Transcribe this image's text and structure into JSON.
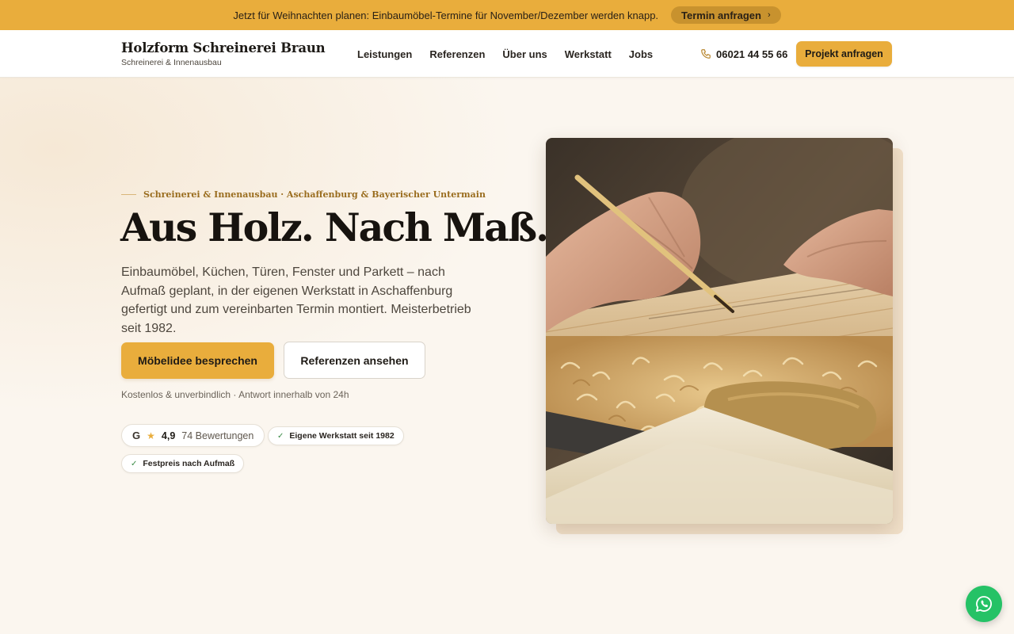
{
  "announcement": {
    "text": "Jetzt für Weihnachten planen: Einbaumöbel-Termine für November/Dezember werden knapp.",
    "button_label": "Termin anfragen",
    "button_icon": "chevron-right-icon"
  },
  "header": {
    "brand_name": "Holzform Schreinerei Braun",
    "brand_tagline": "Schreinerei & Innenausbau",
    "nav": [
      {
        "label": "Leistungen"
      },
      {
        "label": "Referenzen"
      },
      {
        "label": "Über uns"
      },
      {
        "label": "Werkstatt"
      },
      {
        "label": "Jobs"
      }
    ],
    "phone": "06021 44 55 66",
    "phone_icon": "phone-icon",
    "cta_label": "Projekt anfragen"
  },
  "hero": {
    "eyebrow": "Schreinerei & Innenausbau · Aschaffenburg & Bayerischer Untermain",
    "headline": "Aus Holz. Nach Maß.",
    "lede": "Einbaumöbel, Küchen, Türen, Fenster und Parkett – nach Aufmaß geplant, in der eigenen Werkstatt in Aschaffenburg gefertigt und zum vereinbarten Termin montiert. Meisterbetrieb seit 1982.",
    "primary_button": "Möbelidee besprechen",
    "secondary_button": "Referenzen ansehen",
    "fineprint": "Kostenlos & unverbindlich · Antwort innerhalb von 24h",
    "rating": {
      "icon": "google-icon",
      "star_icon": "star-icon",
      "score": "4,9",
      "count": "74 Bewertungen"
    },
    "badges": [
      {
        "label": "Eigene Werkstatt seit 1982",
        "icon": "check-icon"
      },
      {
        "label": "Festpreis nach Aufmaß",
        "icon": "check-icon"
      }
    ],
    "image_subject": "carpenter-marking-wood-photo"
  },
  "fab": {
    "icon": "whatsapp-icon"
  },
  "colors": {
    "accent": "#e9ad3c",
    "accent_dark": "#c8922e",
    "background": "#fbf6ef",
    "eyebrow": "#9a6d1f",
    "whatsapp": "#25c266"
  }
}
